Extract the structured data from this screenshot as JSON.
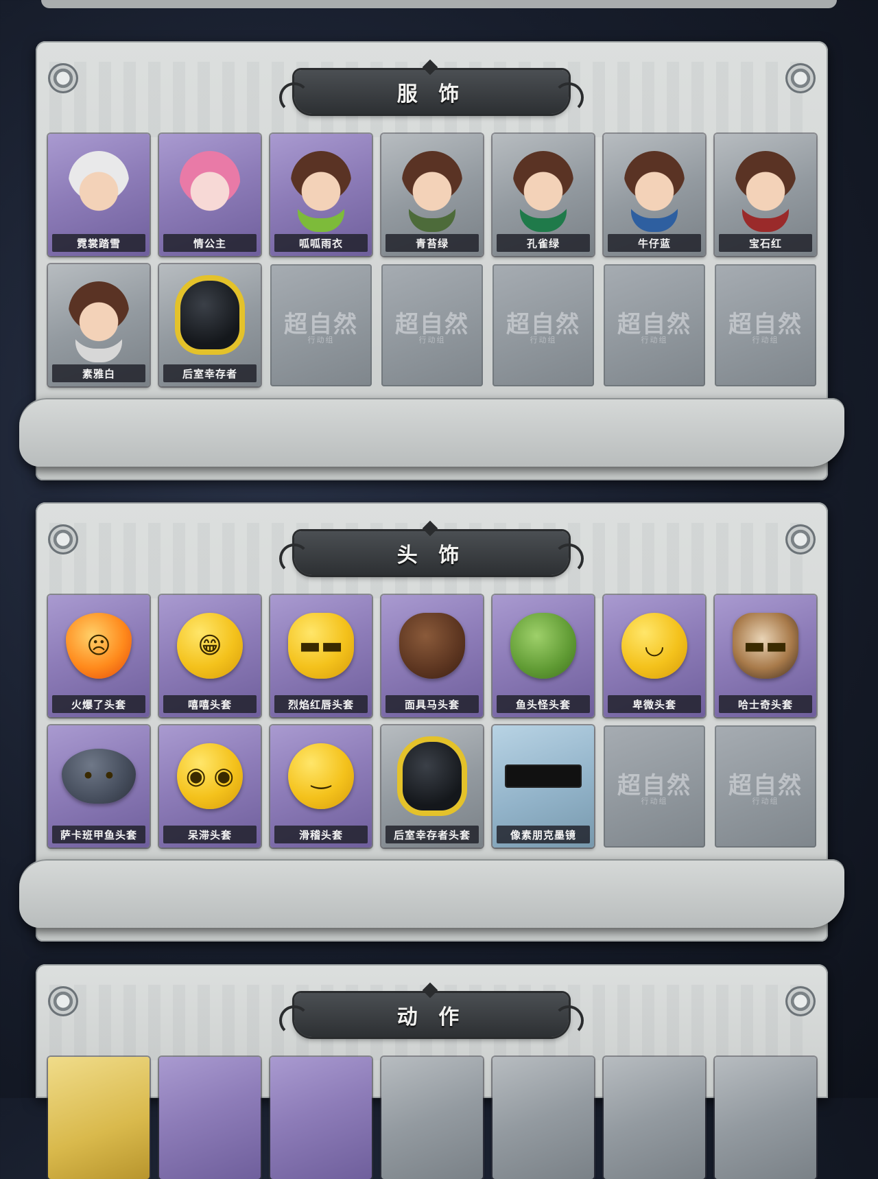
{
  "sections": [
    {
      "title": "服 饰",
      "items": [
        {
          "label": "霓裳踏雪",
          "tier": "purple",
          "art": "character-icon"
        },
        {
          "label": "情公主",
          "tier": "purple",
          "art": "character-icon"
        },
        {
          "label": "呱呱雨衣",
          "tier": "purple",
          "art": "character-icon"
        },
        {
          "label": "青苔绿",
          "tier": "gray",
          "art": "character-icon"
        },
        {
          "label": "孔雀绿",
          "tier": "gray",
          "art": "character-icon"
        },
        {
          "label": "牛仔蓝",
          "tier": "gray",
          "art": "character-icon"
        },
        {
          "label": "宝石红",
          "tier": "gray",
          "art": "character-icon"
        },
        {
          "label": "素雅白",
          "tier": "gray",
          "art": "character-icon"
        },
        {
          "label": "后室幸存者",
          "tier": "gray",
          "art": "hazmat-icon"
        }
      ],
      "empty_slots": 5
    },
    {
      "title": "头 饰",
      "items": [
        {
          "label": "火爆了头套",
          "tier": "purple",
          "art": "flame-icon"
        },
        {
          "label": "嘻嘻头套",
          "tier": "purple",
          "art": "grin-emoji-icon"
        },
        {
          "label": "烈焰红唇头套",
          "tier": "purple",
          "art": "pikachu-icon"
        },
        {
          "label": "面具马头套",
          "tier": "purple",
          "art": "horse-mask-icon"
        },
        {
          "label": "鱼头怪头套",
          "tier": "purple",
          "art": "fish-mask-icon"
        },
        {
          "label": "卑微头套",
          "tier": "purple",
          "art": "shy-emoji-icon"
        },
        {
          "label": "哈士奇头套",
          "tier": "purple",
          "art": "husky-icon"
        },
        {
          "label": "萨卡班甲鱼头套",
          "tier": "purple",
          "art": "fish-head-icon"
        },
        {
          "label": "呆滞头套",
          "tier": "purple",
          "art": "dazed-emoji-icon"
        },
        {
          "label": "滑稽头套",
          "tier": "purple",
          "art": "funny-emoji-icon"
        },
        {
          "label": "后室幸存者头套",
          "tier": "gray",
          "art": "gas-mask-icon"
        },
        {
          "label": "像素朋克墨镜",
          "tier": "blue",
          "art": "pixel-sunglasses-icon"
        }
      ],
      "empty_slots": 2
    },
    {
      "title": "动 作"
    }
  ],
  "empty_slot": {
    "watermark": "超自然",
    "subtitle": "行动组"
  },
  "colors": {
    "purple": "#8d7cb8",
    "gray": "#939aa0",
    "blue": "#92b3c9",
    "gold": "#d9b94c"
  }
}
